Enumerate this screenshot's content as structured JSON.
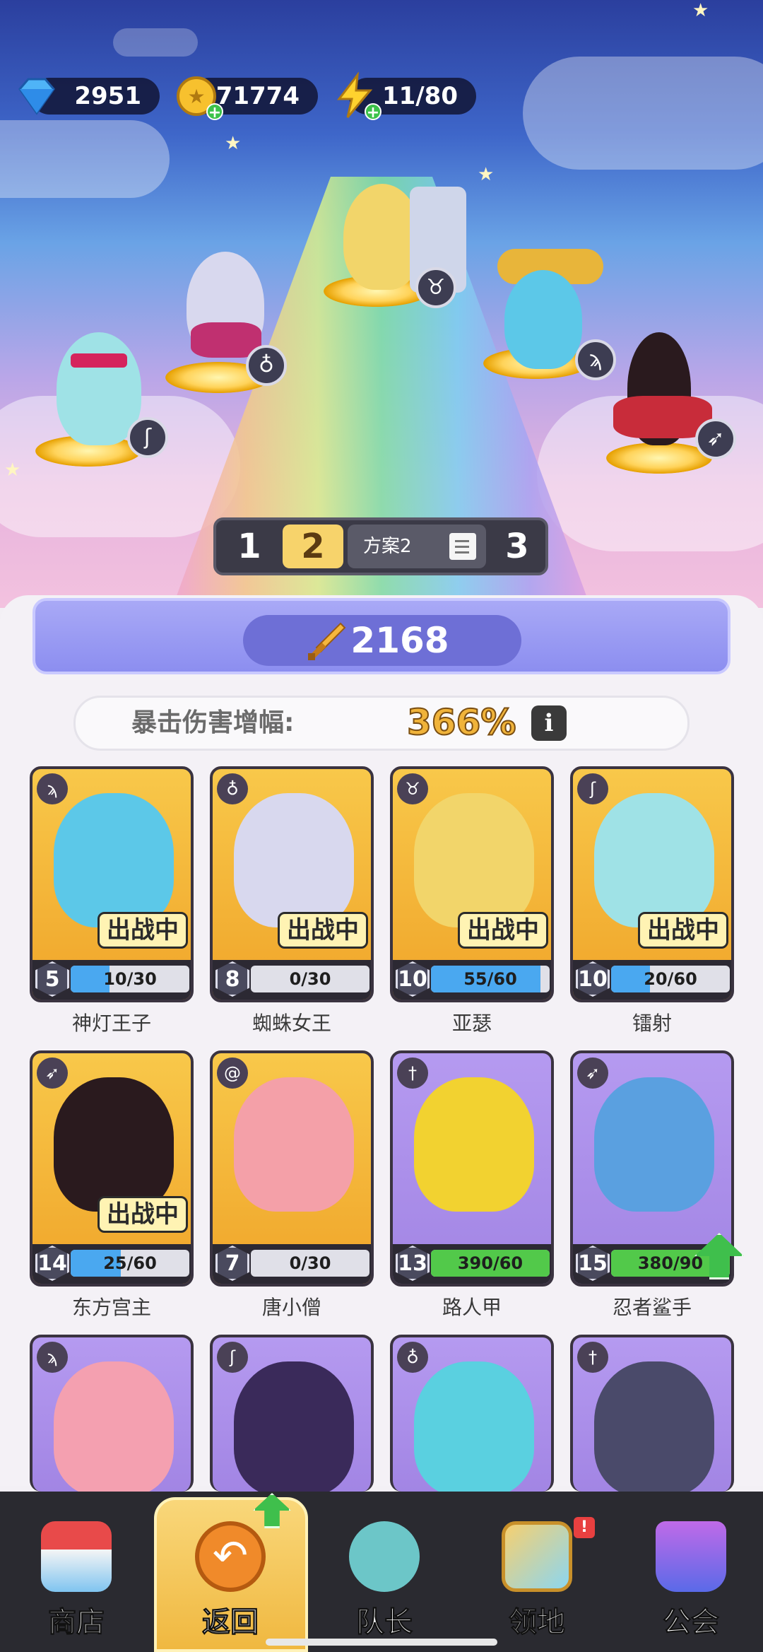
{
  "resources": {
    "gems": "2951",
    "gold": "71774",
    "energy": "11/80"
  },
  "scene_heroes": [
    {
      "name": "镭射",
      "class_icon": "staff-icon"
    },
    {
      "name": "蜘蛛女王",
      "class_icon": "potion-icon"
    },
    {
      "name": "亚瑟",
      "class_icon": "bull-icon"
    },
    {
      "name": "神灯王子",
      "class_icon": "wings-icon"
    },
    {
      "name": "东方宫主",
      "class_icon": "bow-icon"
    }
  ],
  "loadout": {
    "tabs": [
      "1",
      "2",
      "3"
    ],
    "active_tab": "2",
    "plan_label": "方案2"
  },
  "power": "2168",
  "crit": {
    "label": "暴击伤害增幅:",
    "value": "366%",
    "info": "i"
  },
  "cards": [
    {
      "name": "神灯王子",
      "level": "5",
      "progress": "10/30",
      "fill": 0.33,
      "in_battle": "出战中",
      "rarity": "gold",
      "class_icon": "wings-icon",
      "bar": "blue"
    },
    {
      "name": "蜘蛛女王",
      "level": "8",
      "progress": "0/30",
      "fill": 0.0,
      "in_battle": "出战中",
      "rarity": "gold",
      "class_icon": "potion-icon",
      "bar": "blue"
    },
    {
      "name": "亚瑟",
      "level": "10",
      "progress": "55/60",
      "fill": 0.92,
      "in_battle": "出战中",
      "rarity": "gold",
      "class_icon": "bull-icon",
      "bar": "blue"
    },
    {
      "name": "镭射",
      "level": "10",
      "progress": "20/60",
      "fill": 0.33,
      "in_battle": "出战中",
      "rarity": "gold",
      "class_icon": "staff-icon",
      "bar": "blue"
    },
    {
      "name": "东方宫主",
      "level": "14",
      "progress": "25/60",
      "fill": 0.42,
      "in_battle": "出战中",
      "rarity": "gold",
      "class_icon": "bow-icon",
      "bar": "blue"
    },
    {
      "name": "唐小僧",
      "level": "7",
      "progress": "0/30",
      "fill": 0.0,
      "in_battle": "",
      "rarity": "gold",
      "class_icon": "swirl-icon",
      "bar": "blue"
    },
    {
      "name": "路人甲",
      "level": "13",
      "progress": "390/60",
      "fill": 1.0,
      "in_battle": "",
      "rarity": "purple",
      "class_icon": "sword-icon",
      "bar": "green"
    },
    {
      "name": "忍者鲨手",
      "level": "15",
      "progress": "380/90",
      "fill": 1.0,
      "in_battle": "",
      "rarity": "purple",
      "class_icon": "bow-icon",
      "bar": "green"
    }
  ],
  "partial_cards": [
    {
      "class_icon": "wings-icon"
    },
    {
      "class_icon": "staff-icon"
    },
    {
      "class_icon": "potion-icon"
    },
    {
      "class_icon": "sword-icon"
    }
  ],
  "nav": {
    "shop": "商店",
    "back": "返回",
    "captain": "队长",
    "territory": "领地",
    "guild": "公会",
    "territory_badge": "!"
  },
  "colors": {
    "gold_card": "#f8c84a",
    "purple_card": "#b59af0",
    "blue_bar": "#4aa8f0",
    "green_bar": "#52c94a",
    "power_band": "#a9a9f6"
  }
}
